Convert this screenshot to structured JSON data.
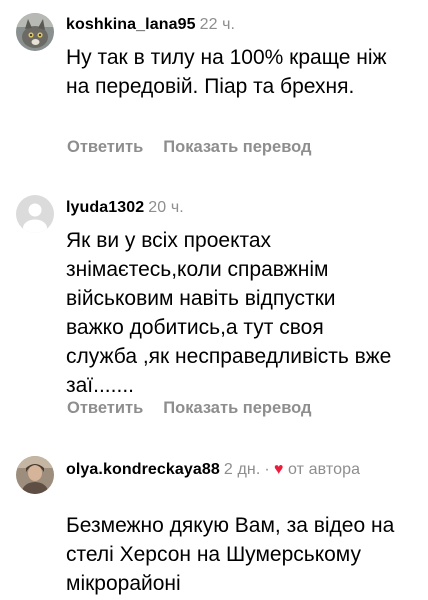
{
  "comments": [
    {
      "username": "koshkina_lana95",
      "time": "22 ч.",
      "text": "Ну так в тилу на 100% краще ніж на передовій. Піар та брехня.",
      "reply_label": "Ответить",
      "translate_label": "Показать перевод",
      "avatar": "cat-photo"
    },
    {
      "username": "lyuda1302",
      "time": "20 ч.",
      "text": "Як ви у всіх проектах знімаєтесь,коли справжнім військовим навіть відпустки важко добитись,а тут своя служба ,як несправедливість вже заї.......",
      "reply_label": "Ответить",
      "translate_label": "Показать перевод",
      "avatar": "default-user"
    },
    {
      "username": "olya.kondreckaya88",
      "time": "2 дн.",
      "separator": "·",
      "liked_by_author_label": "от автора",
      "text": "Безмежно дякую Вам, за відео на стелі Херсон на Шумерському мікрорайоні",
      "avatar": "person-photo"
    }
  ],
  "colors": {
    "meta_gray": "#8e8e8e",
    "heart_red": "#ed1c3d"
  }
}
